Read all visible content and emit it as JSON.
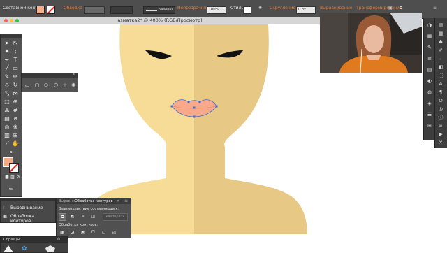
{
  "control_bar": {
    "object_type": "Составной контур",
    "stroke_label": "Обводка",
    "stroke_style": "Базовая",
    "opacity_label": "Непрозрачность",
    "opacity_value": "100%",
    "style_label": "Стиль",
    "corner_label": "Скругление",
    "corner_value": "0 px",
    "align_label": "Выравнивание",
    "transform_label": "Трансформирование",
    "fill_color": "#f5b08a"
  },
  "document": {
    "title": "азматка2* @ 400% (RGB/Просмотр)"
  },
  "colors": {
    "face_light": "#f7dc98",
    "face_shadow": "#e8c885",
    "lips": "#f7a98a",
    "canvas_bg": "#ffffff",
    "ui_panel": "#535353"
  },
  "panels": {
    "align_panel": {
      "title": "Выравнивание"
    },
    "pathfinder_panel": {
      "title": "Обработка контуров"
    },
    "pathfinder_window": {
      "tab_align": "Выравни",
      "tab_pathfinder": "Обработка контуров",
      "shape_modes_label": "Взаимодействие составляющих:",
      "expand_button": "Разобрать",
      "pathfinders_label": "Обработка контуров:"
    },
    "swatches_panel": {
      "title": "Образцы"
    }
  },
  "icons": {
    "toolbar": [
      "selection-icon",
      "direct-selection-icon",
      "magic-wand-icon",
      "lasso-icon",
      "pen-icon",
      "type-icon",
      "line-icon",
      "rectangle-icon",
      "paintbrush-icon",
      "pencil-icon",
      "eraser-icon",
      "rotate-icon",
      "scale-icon",
      "width-icon",
      "free-transform-icon",
      "shape-builder-icon",
      "perspective-icon",
      "mesh-icon",
      "gradient-icon",
      "eyedropper-icon",
      "blend-icon",
      "symbol-sprayer-icon",
      "graph-icon",
      "artboard-icon",
      "slice-icon",
      "hand-icon",
      "zoom-icon"
    ],
    "right_a": [
      "color-icon",
      "color-guide-icon",
      "brushes-icon",
      "stroke-icon",
      "gradient-panel-icon",
      "transparency-icon",
      "appearance-icon",
      "graphic-styles-icon",
      "layers-icon",
      "artboards-icon"
    ],
    "right_b": [
      "libraries-icon",
      "swatches-icon",
      "symbols-icon",
      "brush-library-icon",
      "align-icon",
      "pathfinder-icon",
      "transform-icon",
      "character-icon",
      "paragraph-icon",
      "opentype-icon",
      "navigator-icon",
      "info-icon",
      "links-icon",
      "actions-icon",
      "variables-icon"
    ]
  }
}
